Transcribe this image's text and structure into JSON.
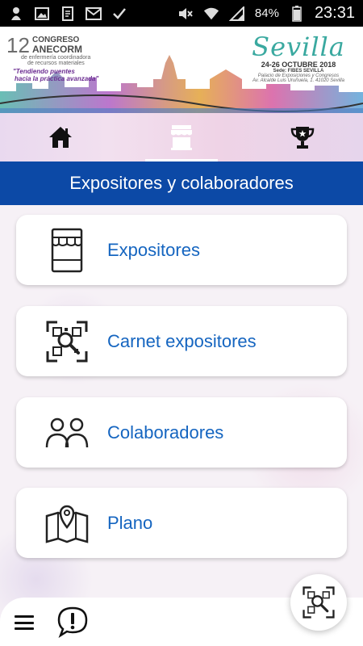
{
  "status_bar": {
    "battery": "84%",
    "time": "23:31"
  },
  "banner": {
    "congress_number": "12",
    "congress_line1": "CONGRESO",
    "congress_line2": "ANECORM",
    "congress_sub1": "de enfermería coordinadora",
    "congress_sub2": "de recursos materiales",
    "slogan_line1": "\"Tendiendo puentes",
    "slogan_line2": "hacia la práctica avanzada\"",
    "city": "Sevilla",
    "dates": "24-26 OCTUBRE 2018",
    "venue_line1": "Sede: FIBES SEVILLA",
    "venue_line2": "Palacio de Exposiciones y Congresos",
    "venue_line3": "Av. Alcalde Luis Uruñuela, 1. 41020 Sevilla"
  },
  "tabs": [
    {
      "icon": "home-icon"
    },
    {
      "icon": "store-icon",
      "active": true
    },
    {
      "icon": "trophy-icon"
    }
  ],
  "header": {
    "title": "Expositores y colaboradores"
  },
  "menu": [
    {
      "label": "Expositores",
      "icon": "store-icon"
    },
    {
      "label": "Carnet expositores",
      "icon": "qr-scan-icon"
    },
    {
      "label": "Colaboradores",
      "icon": "people-icon"
    },
    {
      "label": "Plano",
      "icon": "map-pin-icon"
    }
  ],
  "colors": {
    "header_bg": "#0c49a6",
    "menu_text": "#1565c0",
    "accent_teal": "#3aa9a0"
  }
}
